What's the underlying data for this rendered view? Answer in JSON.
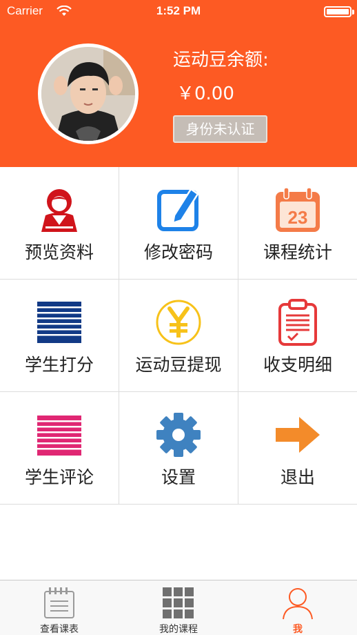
{
  "status_bar": {
    "carrier": "Carrier",
    "time": "1:52 PM"
  },
  "profile": {
    "balance_label": "运动豆余额:",
    "balance_value": "￥0.00",
    "verify_status": "身份未认证"
  },
  "menu": [
    {
      "label": "预览资料",
      "icon": "profile-icon"
    },
    {
      "label": "修改密码",
      "icon": "edit-icon"
    },
    {
      "label": "课程统计",
      "icon": "calendar-icon"
    },
    {
      "label": "学生打分",
      "icon": "list-lines-icon"
    },
    {
      "label": "运动豆提现",
      "icon": "yen-coin-icon"
    },
    {
      "label": "收支明细",
      "icon": "clipboard-icon"
    },
    {
      "label": "学生评论",
      "icon": "comment-lines-icon"
    },
    {
      "label": "设置",
      "icon": "gear-icon"
    },
    {
      "label": "退出",
      "icon": "arrow-right-icon"
    }
  ],
  "calendar_day": "23",
  "tabs": [
    {
      "label": "查看课表",
      "icon": "schedule-icon"
    },
    {
      "label": "我的课程",
      "icon": "grid-icon"
    },
    {
      "label": "我",
      "icon": "person-icon",
      "active": true
    }
  ],
  "colors": {
    "accent": "#fd5a23",
    "badge_bg": "#c5bdb6"
  }
}
